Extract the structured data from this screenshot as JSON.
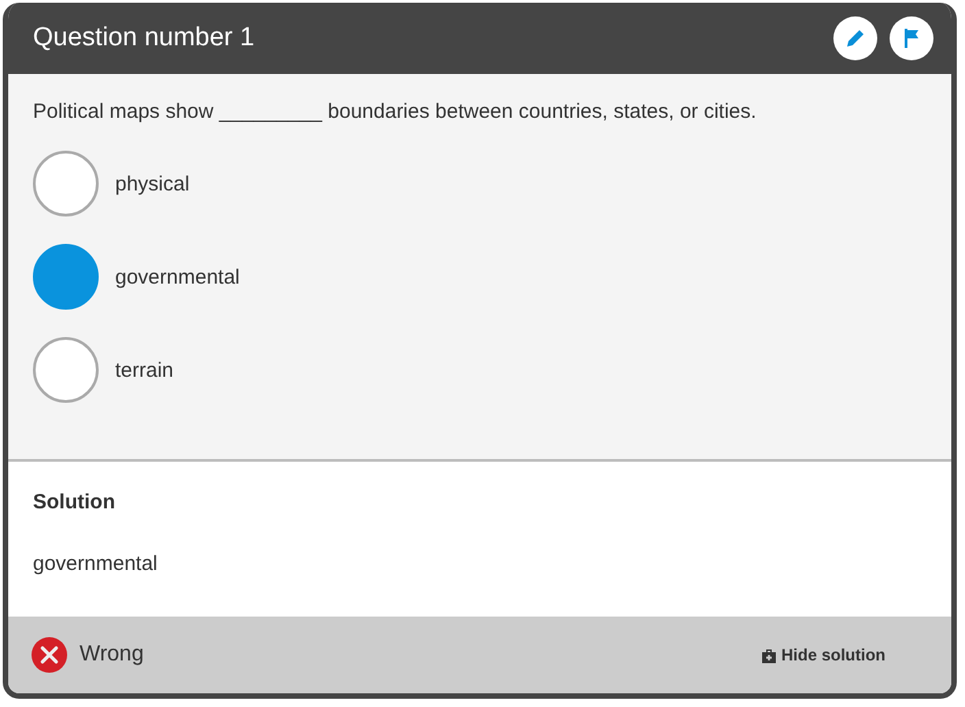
{
  "header": {
    "title": "Question number 1"
  },
  "question": {
    "text": "Political maps show _________ boundaries between countries, states, or cities."
  },
  "options": [
    {
      "label": "physical",
      "selected": false
    },
    {
      "label": "governmental",
      "selected": true
    },
    {
      "label": "terrain",
      "selected": false
    }
  ],
  "solution": {
    "heading": "Solution",
    "answer": "governmental"
  },
  "footer": {
    "result": {
      "kind": "wrong",
      "label": "Wrong"
    },
    "toggle_button": "Hide solution"
  }
}
